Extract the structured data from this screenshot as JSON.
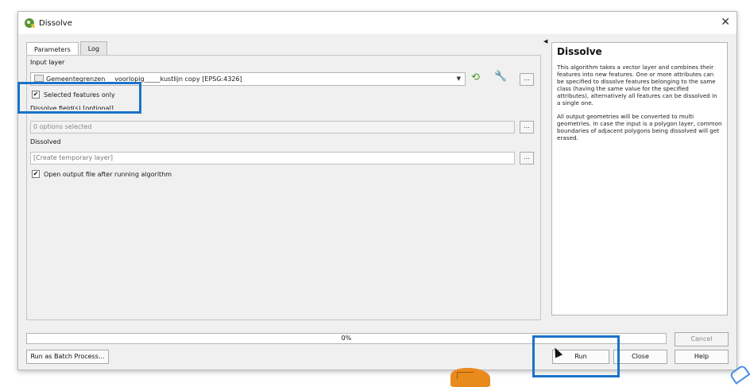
{
  "window": {
    "title": "Dissolve",
    "close_glyph": "✕",
    "app_icon": "qgis-logo-icon"
  },
  "tabs": [
    {
      "label": "Parameters",
      "active": true
    },
    {
      "label": "Log",
      "active": false
    }
  ],
  "params": {
    "input_layer_label": "Input layer",
    "input_layer_value": "Gemeentegrenzen___voorlopig_____kustlijn copy [EPSG:4326]",
    "selected_only_label": "Selected features only",
    "selected_only_checked": true,
    "dissolve_fields_label": "Dissolve field(s) [optional]",
    "dissolve_fields_value": "0 options selected",
    "dissolved_label": "Dissolved",
    "dissolved_placeholder": "[Create temporary layer]",
    "open_output_label": "Open output file after running algorithm",
    "open_output_checked": true,
    "ellipsis": "...",
    "check": "✔",
    "dropdown_arrow": "▼"
  },
  "help": {
    "title": "Dissolve",
    "p1": "This algorithm takes a vector layer and combines their features into new features. One or more attributes can be specified to dissolve features belonging to the same class (having the same value for the specified attributes), alternatively all features can be dissolved in a single one.",
    "p2": "All output geometries will be converted to multi geometries. In case the input is a polygon layer, common boundaries of adjacent polygons being dissolved will get erased."
  },
  "progress": {
    "value": 0,
    "text": "0%"
  },
  "buttons": {
    "batch": "Run as Batch Process...",
    "cancel": "Cancel",
    "run": "Run",
    "close": "Close",
    "help": "Help"
  },
  "colors": {
    "highlight": "#1a73c8",
    "qgis_green": "#589632"
  }
}
